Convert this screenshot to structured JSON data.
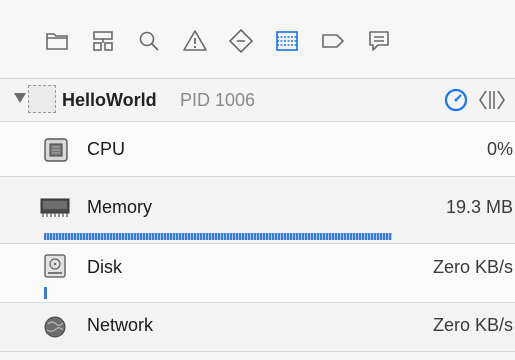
{
  "navigator": {
    "icons": [
      {
        "name": "project-navigator-icon",
        "selected": false
      },
      {
        "name": "symbol-navigator-icon",
        "selected": false
      },
      {
        "name": "find-navigator-icon",
        "selected": false
      },
      {
        "name": "issue-navigator-icon",
        "selected": false
      },
      {
        "name": "test-navigator-icon",
        "selected": false
      },
      {
        "name": "debug-navigator-icon",
        "selected": true
      },
      {
        "name": "breakpoint-navigator-icon",
        "selected": false
      },
      {
        "name": "report-navigator-icon",
        "selected": false
      }
    ],
    "selected_color": "#1a73e8"
  },
  "process": {
    "name": "HelloWorld",
    "pid": "PID 1006"
  },
  "gauges": [
    {
      "label": "CPU",
      "value": "0%",
      "icon": "cpu-icon"
    },
    {
      "label": "Memory",
      "value": "19.3 MB",
      "icon": "memory-icon",
      "bar_fraction": 0.74
    },
    {
      "label": "Disk",
      "value": "Zero KB/s",
      "icon": "disk-icon"
    },
    {
      "label": "Network",
      "value": "Zero KB/s",
      "icon": "network-icon"
    }
  ]
}
